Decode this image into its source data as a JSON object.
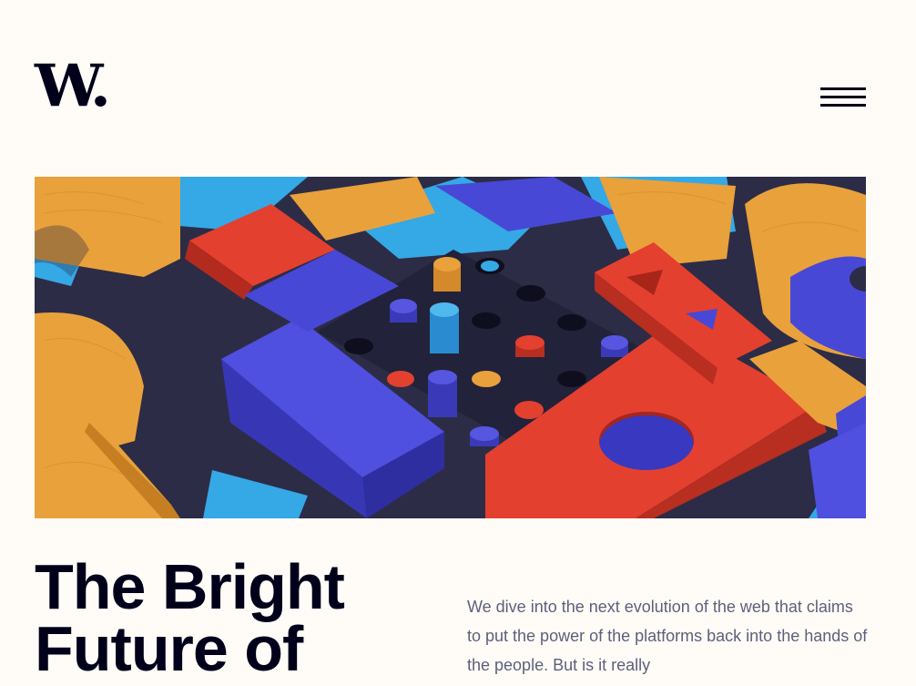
{
  "header": {
    "logo_text": "W.",
    "menu_icon": "hamburger-menu-icon"
  },
  "hero": {
    "image_subject": "abstract colorful 3D wooden blocks"
  },
  "article": {
    "headline": "The Bright Future of",
    "intro": "We dive into the next evolution of the web that claims to put the power of the platforms back into the hands of the people. But is it really"
  },
  "colors": {
    "background": "#FFFCF7",
    "text_dark": "#00001A",
    "text_muted": "#5E607A",
    "block_orange": "#E9A13B",
    "block_red": "#E3402F",
    "block_blue": "#4848D6",
    "block_cyan": "#35A8E6",
    "block_navy": "#2C2C46"
  }
}
